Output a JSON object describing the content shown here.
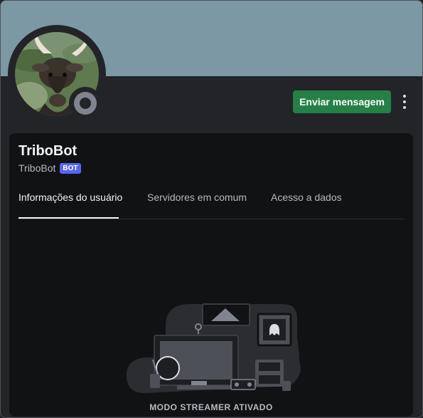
{
  "profile": {
    "username": "TriboBot",
    "tag": "TriboBot",
    "badge": "BOT",
    "status": "offline",
    "banner_color": "#7c98a4"
  },
  "actions": {
    "send_message": "Enviar mensagem",
    "more_icon": "vertical-ellipsis-icon"
  },
  "tabs": [
    {
      "label": "Informações do usuário",
      "active": true
    },
    {
      "label": "Servidores em comum",
      "active": false
    },
    {
      "label": "Acesso a dados",
      "active": false
    }
  ],
  "empty_state": {
    "illustration": "streamer-mode-illustration",
    "text": "MODO STREAMER ATIVADO"
  }
}
